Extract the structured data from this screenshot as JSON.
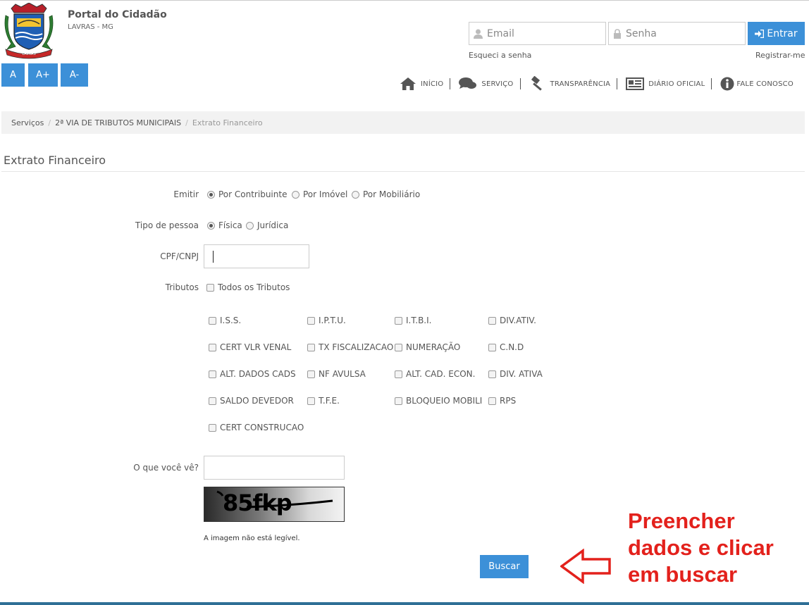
{
  "header": {
    "title": "Portal do Cidadão",
    "subtitle": "LAVRAS - MG",
    "font_buttons": [
      "A",
      "A+",
      "A-"
    ]
  },
  "login": {
    "email_placeholder": "Email",
    "password_placeholder": "Senha",
    "submit_label": "Entrar",
    "forgot_label": "Esqueci a senha",
    "register_label": "Registrar-me"
  },
  "nav": {
    "items": [
      {
        "label": "INÍCIO",
        "icon": "home-icon"
      },
      {
        "label": "SERVIÇO",
        "icon": "comments-icon"
      },
      {
        "label": "TRANSPARÊNCIA",
        "icon": "gavel-icon"
      },
      {
        "label": "DIÁRIO OFICIAL",
        "icon": "newspaper-icon"
      },
      {
        "label": "FALE CONOSCO",
        "icon": "info-icon"
      }
    ]
  },
  "breadcrumb": [
    "Serviços",
    "2ª VIA DE TRIBUTOS MUNICIPAIS",
    "Extrato Financeiro"
  ],
  "page": {
    "title": "Extrato Financeiro"
  },
  "form": {
    "emitir": {
      "label": "Emitir",
      "options": [
        "Por Contribuinte",
        "Por Imóvel",
        "Por Mobiliário"
      ],
      "selected": "Por Contribuinte"
    },
    "tipo_pessoa": {
      "label": "Tipo de pessoa",
      "options": [
        "Física",
        "Jurídica"
      ],
      "selected": "Física"
    },
    "cpf": {
      "label": "CPF/CNPJ",
      "value": ""
    },
    "tributos": {
      "label": "Tributos",
      "all_label": "Todos os Tributos",
      "items": [
        "I.S.S.",
        "I.P.T.U.",
        "I.T.B.I.",
        "DIV.ATIV.",
        "CERT VLR VENAL",
        "TX FISCALIZACAO",
        "NUMERAÇÃO",
        "C.N.D",
        "ALT. DADOS CADS",
        "NF AVULSA",
        "ALT. CAD. ECON.",
        "DIV. ATIVA",
        "SALDO DEVEDOR",
        "T.F.E.",
        "BLOQUEIO MOBILI",
        "RPS",
        "CERT CONSTRUCAO"
      ]
    },
    "captcha": {
      "label": "O que você vê?",
      "value": "",
      "image_text": "85fkp",
      "illegible_label": "A imagem não está legível."
    },
    "submit_label": "Buscar"
  },
  "annotation": {
    "lines": [
      "Preencher",
      "dados e clicar",
      "em buscar"
    ],
    "color": "#e3211c"
  },
  "colors": {
    "primary": "#3c90d8",
    "bottom_bar": "#2f6f96"
  }
}
